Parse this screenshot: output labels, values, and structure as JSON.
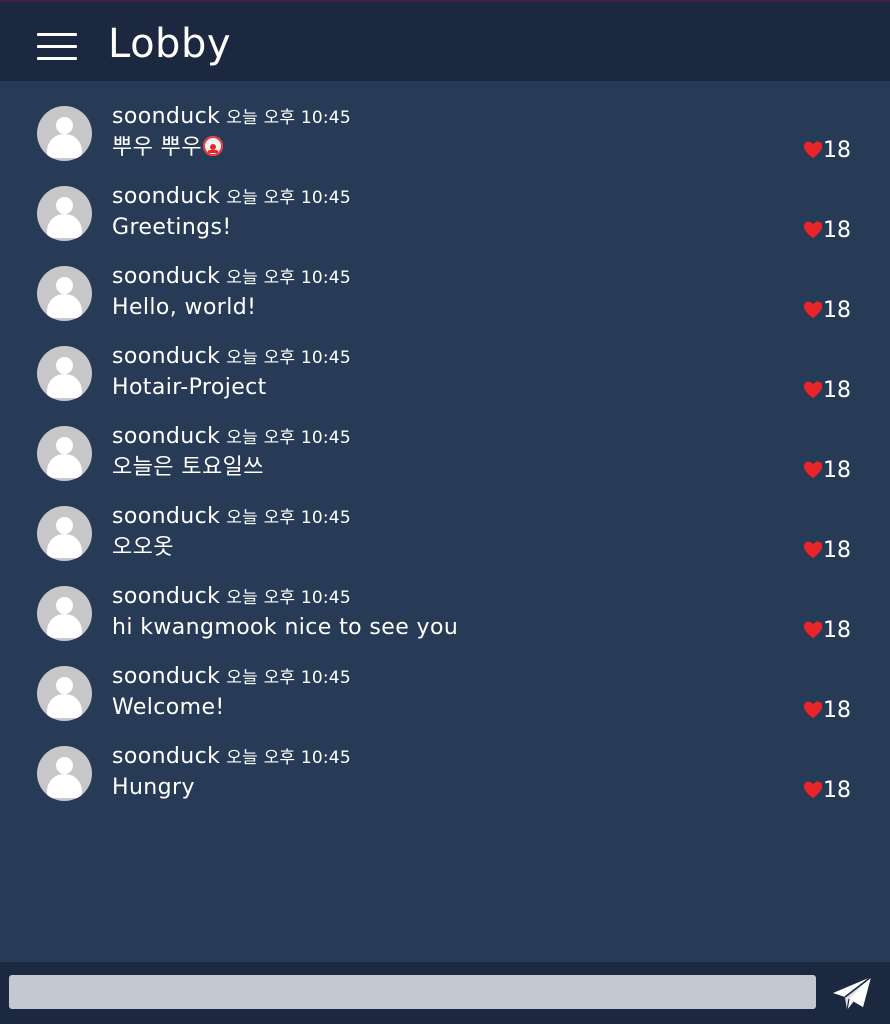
{
  "header": {
    "title": "Lobby"
  },
  "messages": [
    {
      "username": "soonduck",
      "time": "오늘 오후 10:45",
      "text": "뿌우 뿌우",
      "emoji": "clown-face",
      "likes": "18"
    },
    {
      "username": "soonduck",
      "time": "오늘 오후 10:45",
      "text": "Greetings!",
      "likes": "18"
    },
    {
      "username": "soonduck",
      "time": "오늘 오후 10:45",
      "text": "Hello, world!",
      "likes": "18"
    },
    {
      "username": "soonduck",
      "time": "오늘 오후 10:45",
      "text": "Hotair-Project",
      "likes": "18"
    },
    {
      "username": "soonduck",
      "time": "오늘 오후 10:45",
      "text": "오늘은 토요일쓰",
      "likes": "18"
    },
    {
      "username": "soonduck",
      "time": "오늘 오후 10:45",
      "text": "오오옷",
      "likes": "18"
    },
    {
      "username": "soonduck",
      "time": "오늘 오후 10:45",
      "text": "hi kwangmook nice to see you",
      "likes": "18"
    },
    {
      "username": "soonduck",
      "time": "오늘 오후 10:45",
      "text": "Welcome!",
      "likes": "18"
    },
    {
      "username": "soonduck",
      "time": "오늘 오후 10:45",
      "text": "Hungry",
      "likes": "18"
    }
  ],
  "composer": {
    "input_value": "",
    "placeholder": ""
  },
  "icons": {
    "menu": "hamburger-menu-icon",
    "avatar": "default-user-avatar-icon",
    "like": "heart-icon",
    "send": "paper-plane-send-icon"
  },
  "colors": {
    "background": "#283b56",
    "header": "#1c2840",
    "heart": "#e8252a",
    "input": "#c4c8d2"
  }
}
